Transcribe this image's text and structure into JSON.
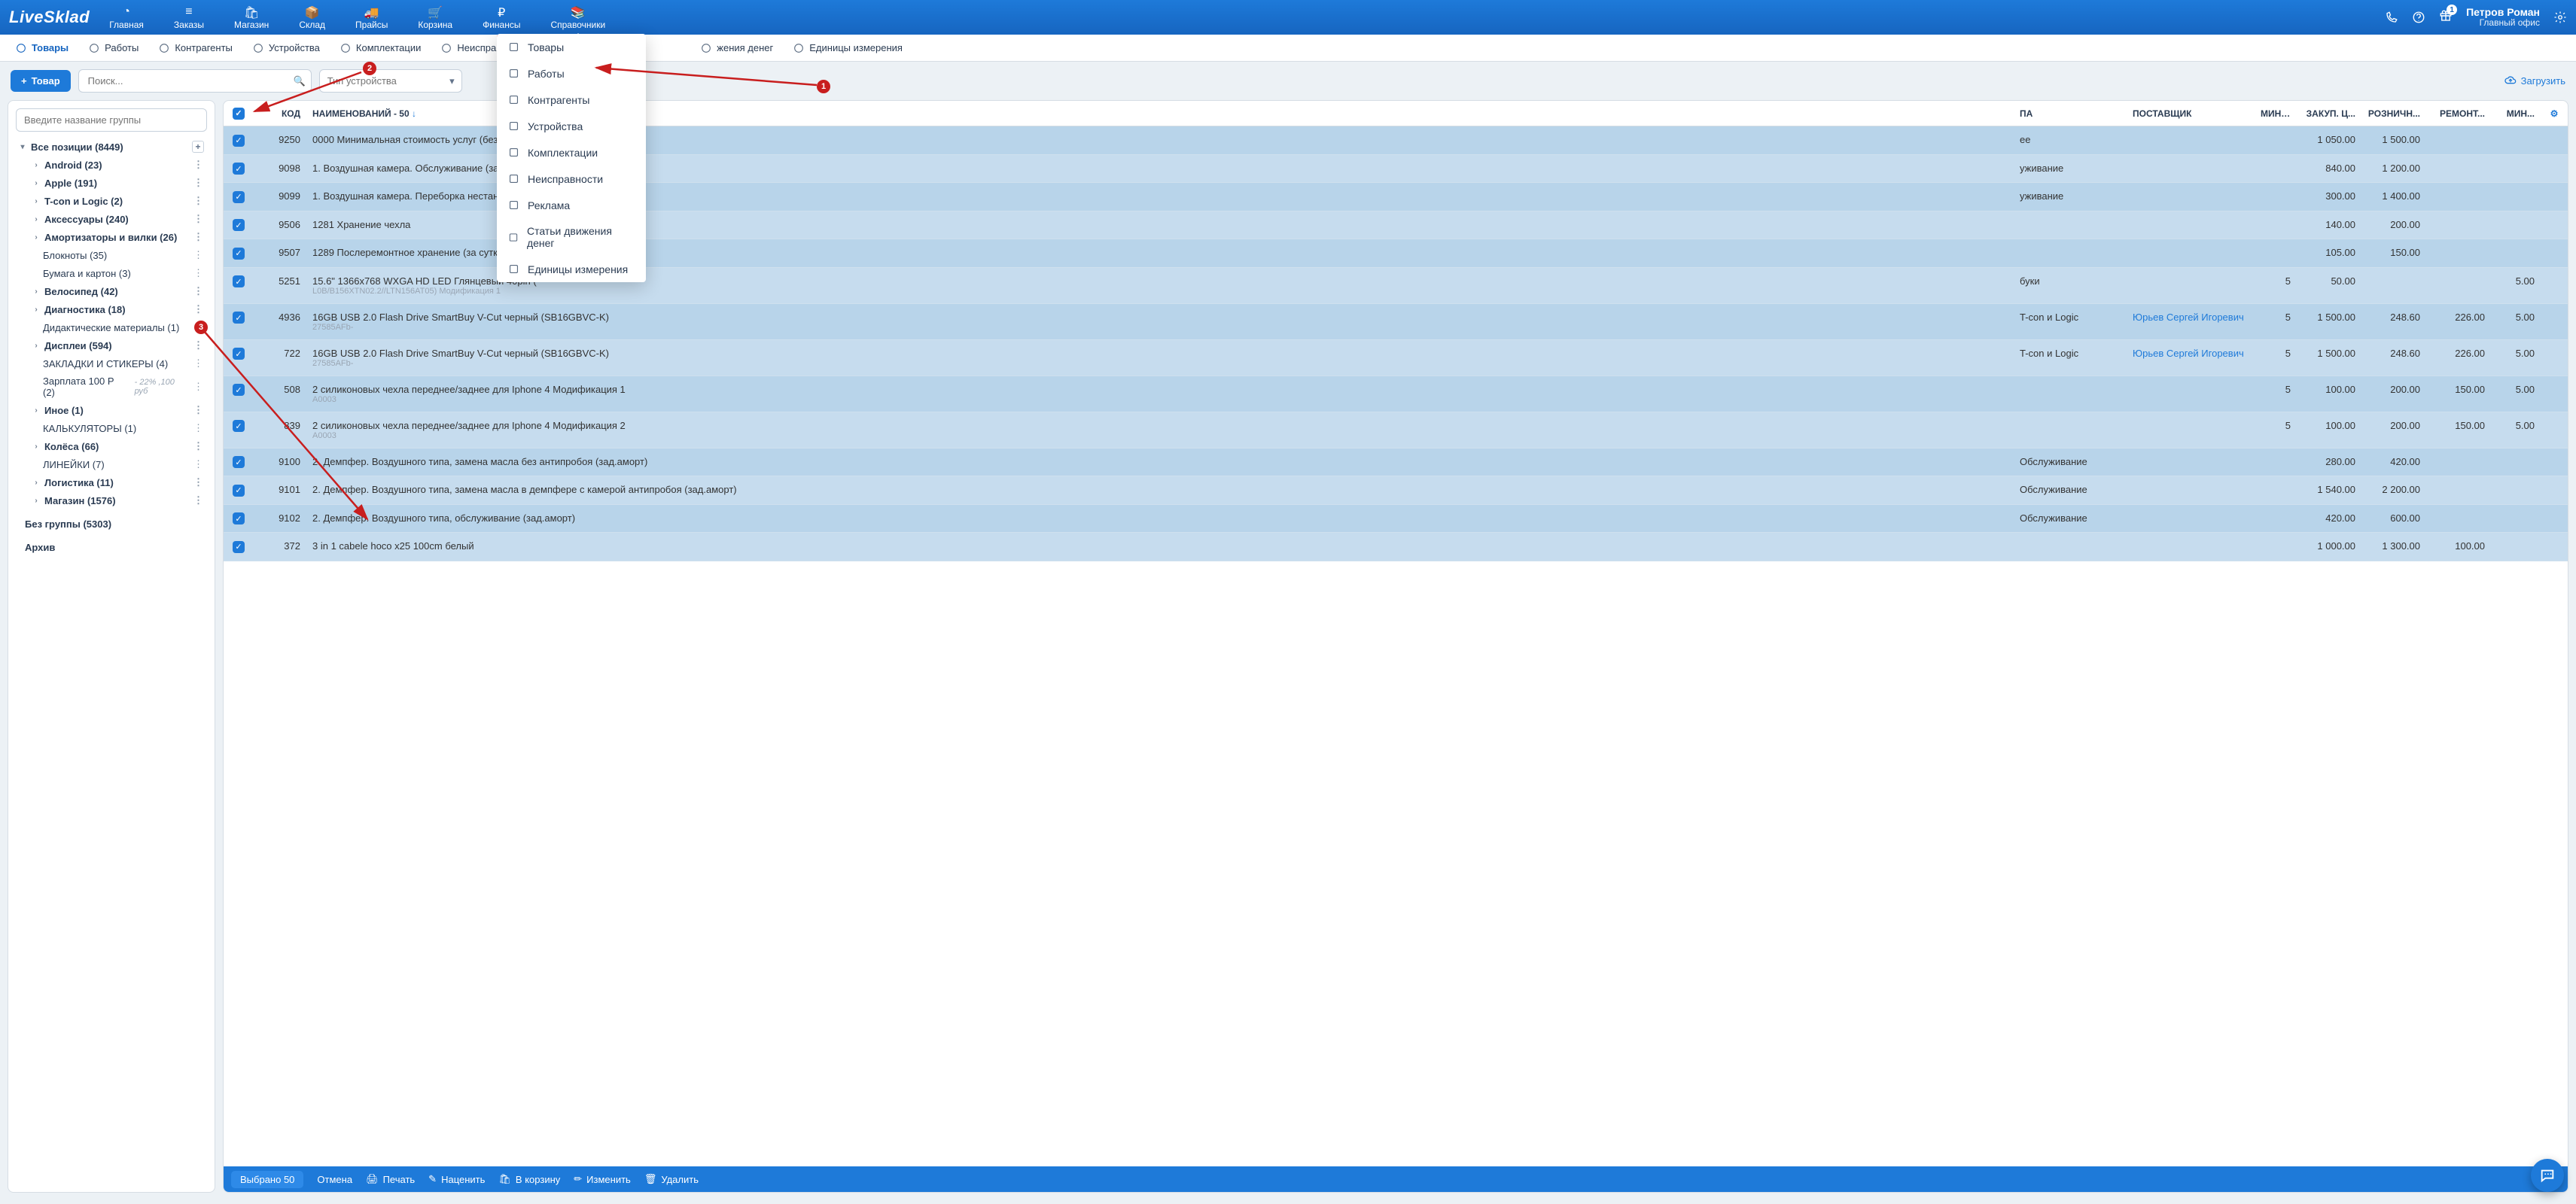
{
  "brand": "LiveSklad",
  "topnav": [
    {
      "label": "Главная"
    },
    {
      "label": "Заказы"
    },
    {
      "label": "Магазин"
    },
    {
      "label": "Склад"
    },
    {
      "label": "Прайсы"
    },
    {
      "label": "Корзина"
    },
    {
      "label": "Финансы"
    },
    {
      "label": "Справочники"
    }
  ],
  "user": {
    "name": "Петров Роман",
    "office": "Главный офис"
  },
  "subtabs": [
    "Товары",
    "Работы",
    "Контрагенты",
    "Устройства",
    "Комплектации",
    "Неисправности",
    "",
    "жения денег",
    "Единицы измерения"
  ],
  "toolbar": {
    "add": "Товар",
    "search_ph": "Поиск...",
    "device_ph": "Тип устройства",
    "upload": "Загрузить"
  },
  "sidebar": {
    "group_ph": "Введите название группы",
    "root": "Все позиции (8449)",
    "items": [
      {
        "label": "Android (23)",
        "bold": true,
        "chev": true
      },
      {
        "label": "Apple (191)",
        "bold": true,
        "chev": true
      },
      {
        "label": "T-con и Logic (2)",
        "bold": true,
        "chev": true
      },
      {
        "label": "Аксессуары (240)",
        "bold": true,
        "chev": true
      },
      {
        "label": "Амортизаторы и вилки (26)",
        "bold": true,
        "chev": true
      },
      {
        "label": "Блокноты (35)",
        "bold": false,
        "chev": false,
        "leaf": true
      },
      {
        "label": "Бумага и картон (3)",
        "bold": false,
        "chev": false,
        "leaf": true
      },
      {
        "label": "Велосипед (42)",
        "bold": true,
        "chev": true
      },
      {
        "label": "Диагностика (18)",
        "bold": true,
        "chev": true
      },
      {
        "label": "Дидактические материалы (1)",
        "bold": false,
        "chev": false,
        "leaf": true
      },
      {
        "label": "Дисплеи (594)",
        "bold": true,
        "chev": true
      },
      {
        "label": "ЗАКЛАДКИ И СТИКЕРЫ (4)",
        "bold": false,
        "chev": false,
        "leaf": true
      },
      {
        "label": "Зарплата 100 Р (2)",
        "bold": false,
        "chev": false,
        "leaf": true,
        "extra": "- 22% ,100 руб"
      },
      {
        "label": "Иное (1)",
        "bold": true,
        "chev": true
      },
      {
        "label": "КАЛЬКУЛЯТОРЫ (1)",
        "bold": false,
        "chev": false,
        "leaf": true
      },
      {
        "label": "Колёса (66)",
        "bold": true,
        "chev": true
      },
      {
        "label": "ЛИНЕЙКИ (7)",
        "bold": false,
        "chev": false,
        "leaf": true
      },
      {
        "label": "Логистика (11)",
        "bold": true,
        "chev": true
      },
      {
        "label": "Магазин (1576)",
        "bold": true,
        "chev": true
      }
    ],
    "nogroup": "Без группы (5303)",
    "archive": "Архив"
  },
  "columns": [
    "КОД",
    "НАИМЕНОВАНИЙ - 50",
    "ПА",
    "ПОСТАВЩИК",
    "МИН. ...",
    "ЗАКУП. Ц...",
    "РОЗНИЧН...",
    "РЕМОНТ...",
    "МИН..."
  ],
  "sort_arrow": "↓",
  "rows": [
    {
      "code": "9250",
      "name": "0000 Минимальная стоимость услуг (без учета",
      "grp": "ee",
      "sup": "",
      "min": "",
      "buy": "1 050.00",
      "ret": "1 500.00",
      "rep": "",
      "min2": ""
    },
    {
      "code": "9098",
      "name": "1. Воздушная камера. Обслуживание (зад.аморт",
      "grp": "уживание",
      "sup": "",
      "min": "",
      "buy": "840.00",
      "ret": "1 200.00",
      "rep": "",
      "min2": ""
    },
    {
      "code": "9099",
      "name": "1. Воздушная камера. Переборка нестандартно",
      "grp": "уживание",
      "sup": "",
      "min": "",
      "buy": "300.00",
      "ret": "1 400.00",
      "rep": "",
      "min2": ""
    },
    {
      "code": "9506",
      "name": "1281 Хранение чехла",
      "grp": "",
      "sup": "",
      "min": "",
      "buy": "140.00",
      "ret": "200.00",
      "rep": "",
      "min2": ""
    },
    {
      "code": "9507",
      "name": "1289 Послеремонтное хранение (за сутки)",
      "grp": "",
      "sup": "",
      "min": "",
      "buy": "105.00",
      "ret": "150.00",
      "rep": "",
      "min2": ""
    },
    {
      "code": "5251",
      "name": "15.6\" 1366x768 WXGA HD LED Глянцевый 40pin (",
      "sub": "L0B/B156XTN02.2//LTN156AT05) Модификация 1",
      "grp": "буки",
      "sup": "",
      "min": "5",
      "buy": "50.00",
      "ret": "",
      "rep": "",
      "min2": "5.00"
    },
    {
      "code": "4936",
      "name": "16GB USB 2.0 Flash Drive SmartBuy V-Cut черный (SB16GBVC-K)",
      "sub": "27585AFb-",
      "grp": "T-con и Logic",
      "sup": "Юрьев Сергей Игоревич",
      "suplink": true,
      "min": "5",
      "buy": "1 500.00",
      "ret": "248.60",
      "rep": "226.00",
      "min2": "5.00"
    },
    {
      "code": "722",
      "name": "16GB USB 2.0 Flash Drive SmartBuy V-Cut черный (SB16GBVC-K)",
      "sub": "27585AFb-",
      "grp": "T-con и Logic",
      "sup": "Юрьев Сергей Игоревич",
      "suplink": true,
      "min": "5",
      "buy": "1 500.00",
      "ret": "248.60",
      "rep": "226.00",
      "min2": "5.00"
    },
    {
      "code": "508",
      "name": "2 силиконовых чехла переднее/заднее для Iphone 4 Модификация 1",
      "sub": "A0003",
      "grp": "",
      "sup": "",
      "min": "5",
      "buy": "100.00",
      "ret": "200.00",
      "rep": "150.00",
      "min2": "5.00"
    },
    {
      "code": "839",
      "name": "2 силиконовых чехла переднее/заднее для Iphone 4 Модификация 2",
      "sub": "A0003",
      "grp": "",
      "sup": "",
      "min": "5",
      "buy": "100.00",
      "ret": "200.00",
      "rep": "150.00",
      "min2": "5.00"
    },
    {
      "code": "9100",
      "name": "2. Демпфер. Воздушного типа, замена масла без антипробоя (зад.аморт)",
      "grp": "Обслуживание",
      "sup": "",
      "min": "",
      "buy": "280.00",
      "ret": "420.00",
      "rep": "",
      "min2": ""
    },
    {
      "code": "9101",
      "name": "2. Демпфер. Воздушного типа, замена масла в демпфере с камерой антипробоя (зад.аморт)",
      "grp": "Обслуживание",
      "sup": "",
      "min": "",
      "buy": "1 540.00",
      "ret": "2 200.00",
      "rep": "",
      "min2": ""
    },
    {
      "code": "9102",
      "name": "2. Демпфер. Воздушного типа, обслуживание (зад.аморт)",
      "grp": "Обслуживание",
      "sup": "",
      "min": "",
      "buy": "420.00",
      "ret": "600.00",
      "rep": "",
      "min2": ""
    },
    {
      "code": "372",
      "name": "3 in 1 cabele hoco x25 100cm белый",
      "grp": "",
      "sup": "",
      "min": "",
      "buy": "1 000.00",
      "ret": "1 300.00",
      "rep": "100.00",
      "min2": ""
    }
  ],
  "footer": {
    "selected": "Выбрано 50",
    "cancel": "Отмена",
    "print": "Печать",
    "markup": "Наценить",
    "cart": "В корзину",
    "edit": "Изменить",
    "del": "Удалить"
  },
  "dropdown": [
    "Товары",
    "Работы",
    "Контрагенты",
    "Устройства",
    "Комплектации",
    "Неисправности",
    "Реклама",
    "Статьи движения денег",
    "Единицы измерения"
  ]
}
